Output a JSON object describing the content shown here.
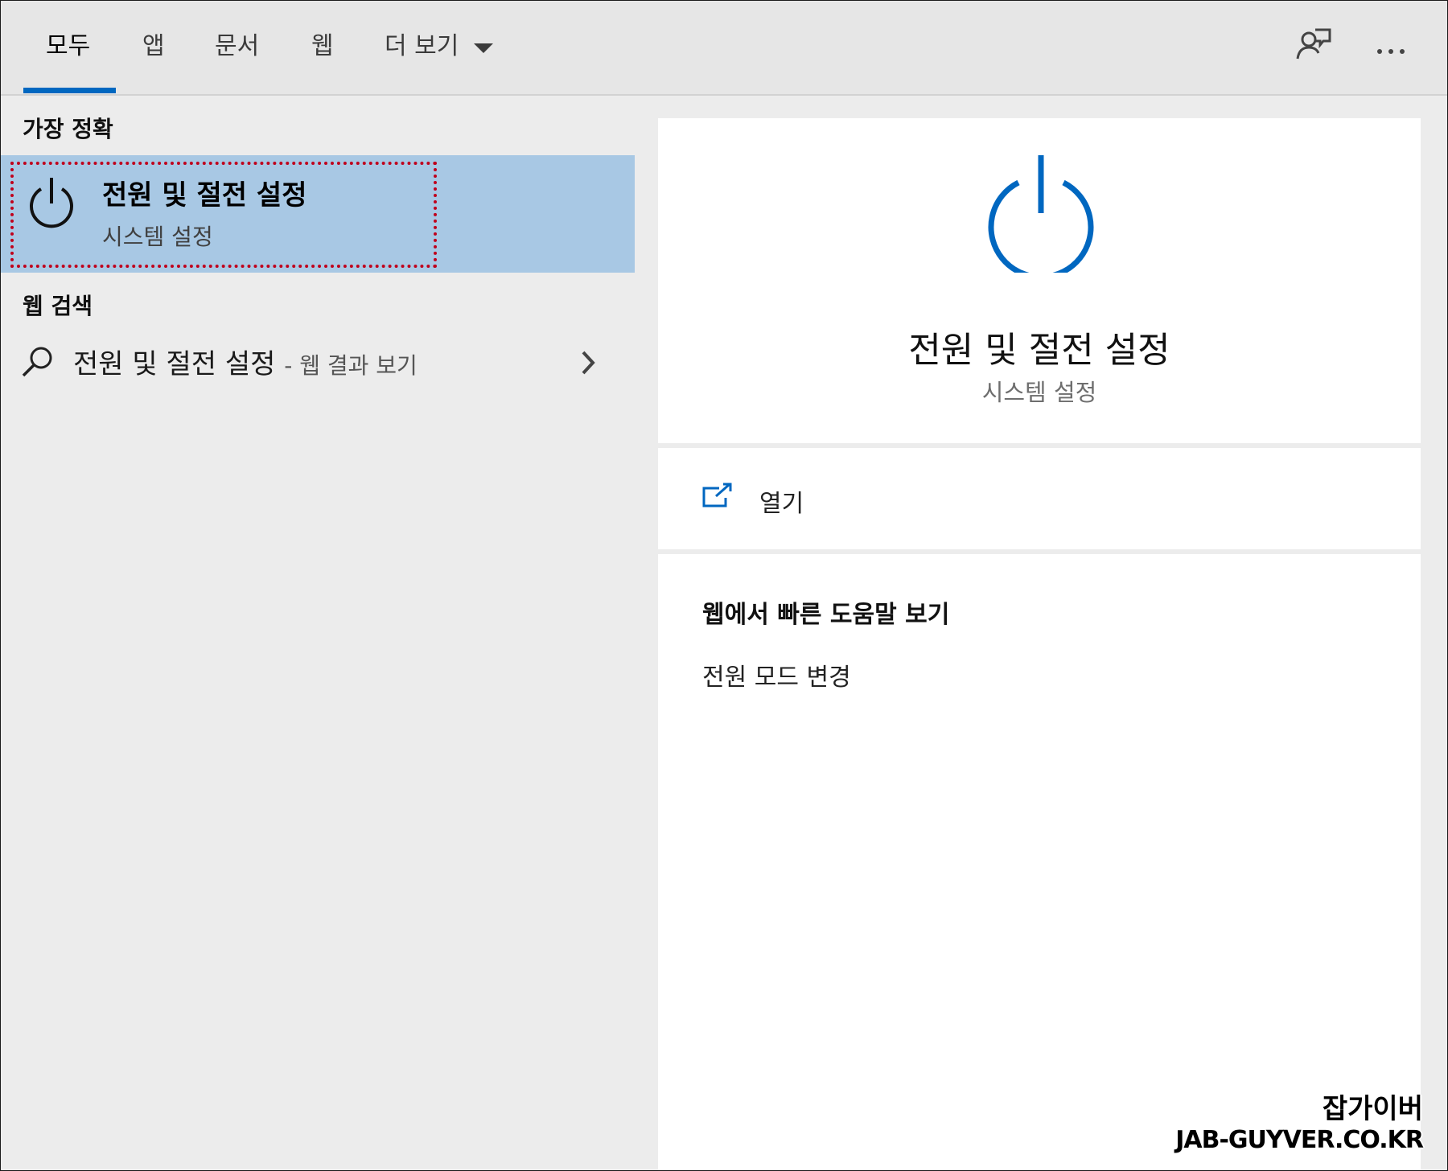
{
  "tabs": {
    "all": "모두",
    "apps": "앱",
    "documents": "문서",
    "web": "웹",
    "more": "더 보기"
  },
  "left": {
    "best_match_label": "가장 정확",
    "best_match": {
      "title": "전원 및 절전 설정",
      "subtitle": "시스템 설정"
    },
    "web_search_label": "웹 검색",
    "web_result": {
      "query": "전원 및 절전 설정",
      "suffix": "- 웹 결과 보기"
    }
  },
  "right": {
    "title": "전원 및 절전 설정",
    "subtitle": "시스템 설정",
    "open_label": "열기",
    "help_heading": "웹에서 빠른 도움말 보기",
    "help_links": [
      "전원 모드 변경"
    ]
  },
  "watermark": {
    "line1": "잡가이버",
    "line2": "JAB-GUYVER.CO.KR"
  },
  "colors": {
    "accent": "#0067c0",
    "selection": "#a8c8e4",
    "highlight_border": "#c0001c"
  }
}
